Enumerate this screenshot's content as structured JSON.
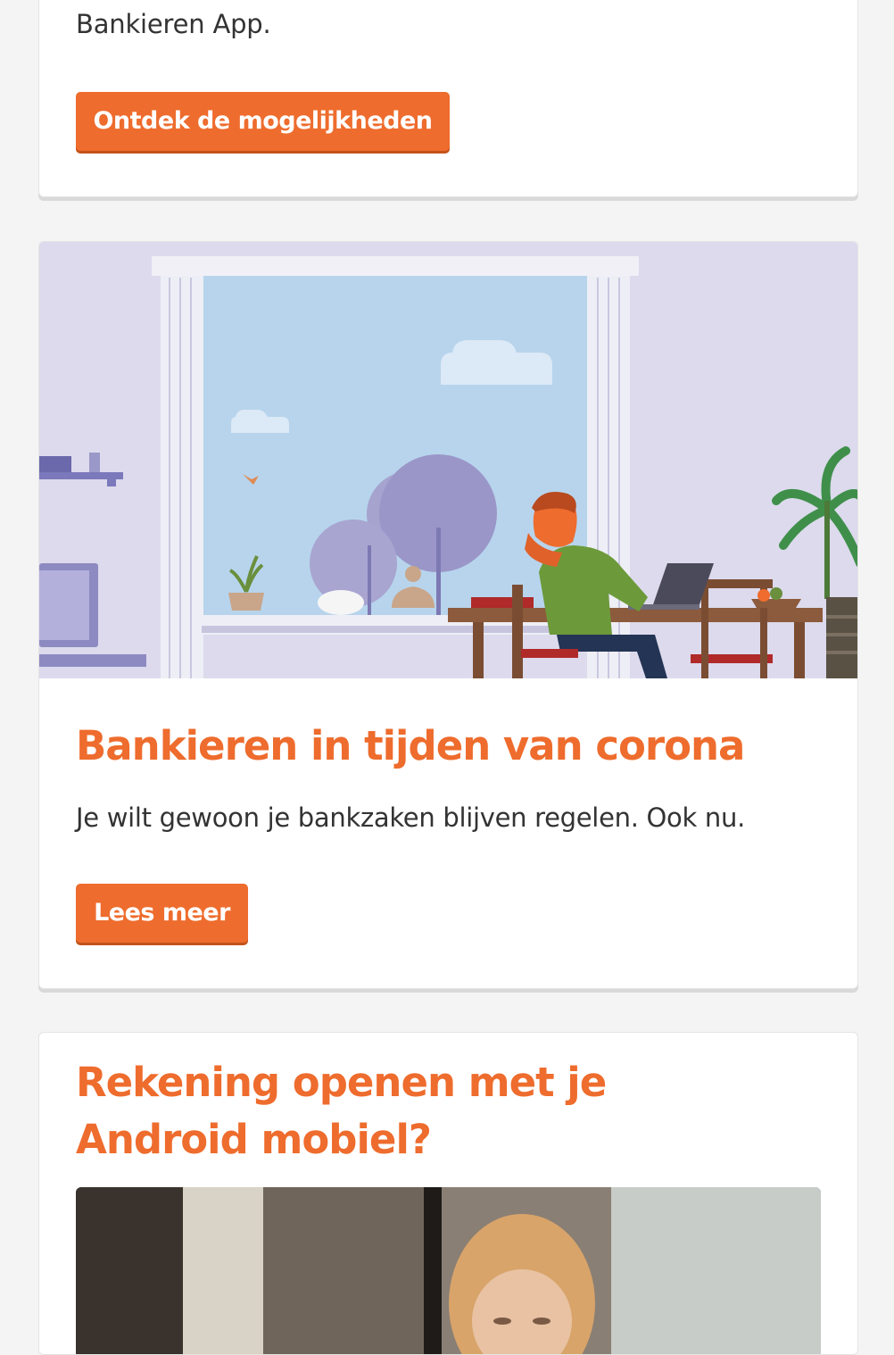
{
  "promo_app": {
    "description_tail": "Bankieren App.",
    "button_label": "Ontdek de mogelijkheden"
  },
  "corona": {
    "title": "Bankieren in tijden van corona",
    "description": "Je wilt gewoon je bankzaken blijven regelen. Ook nu.",
    "button_label": "Lees meer",
    "illustration": "person-working-at-home-illustration"
  },
  "android": {
    "title": "Rekening openen met je Android mobiel?",
    "photo": "woman-looking-at-phone-photo"
  },
  "colors": {
    "accent": "#ee6c2d",
    "text": "#333333",
    "background": "#f4f4f4",
    "card": "#ffffff"
  }
}
